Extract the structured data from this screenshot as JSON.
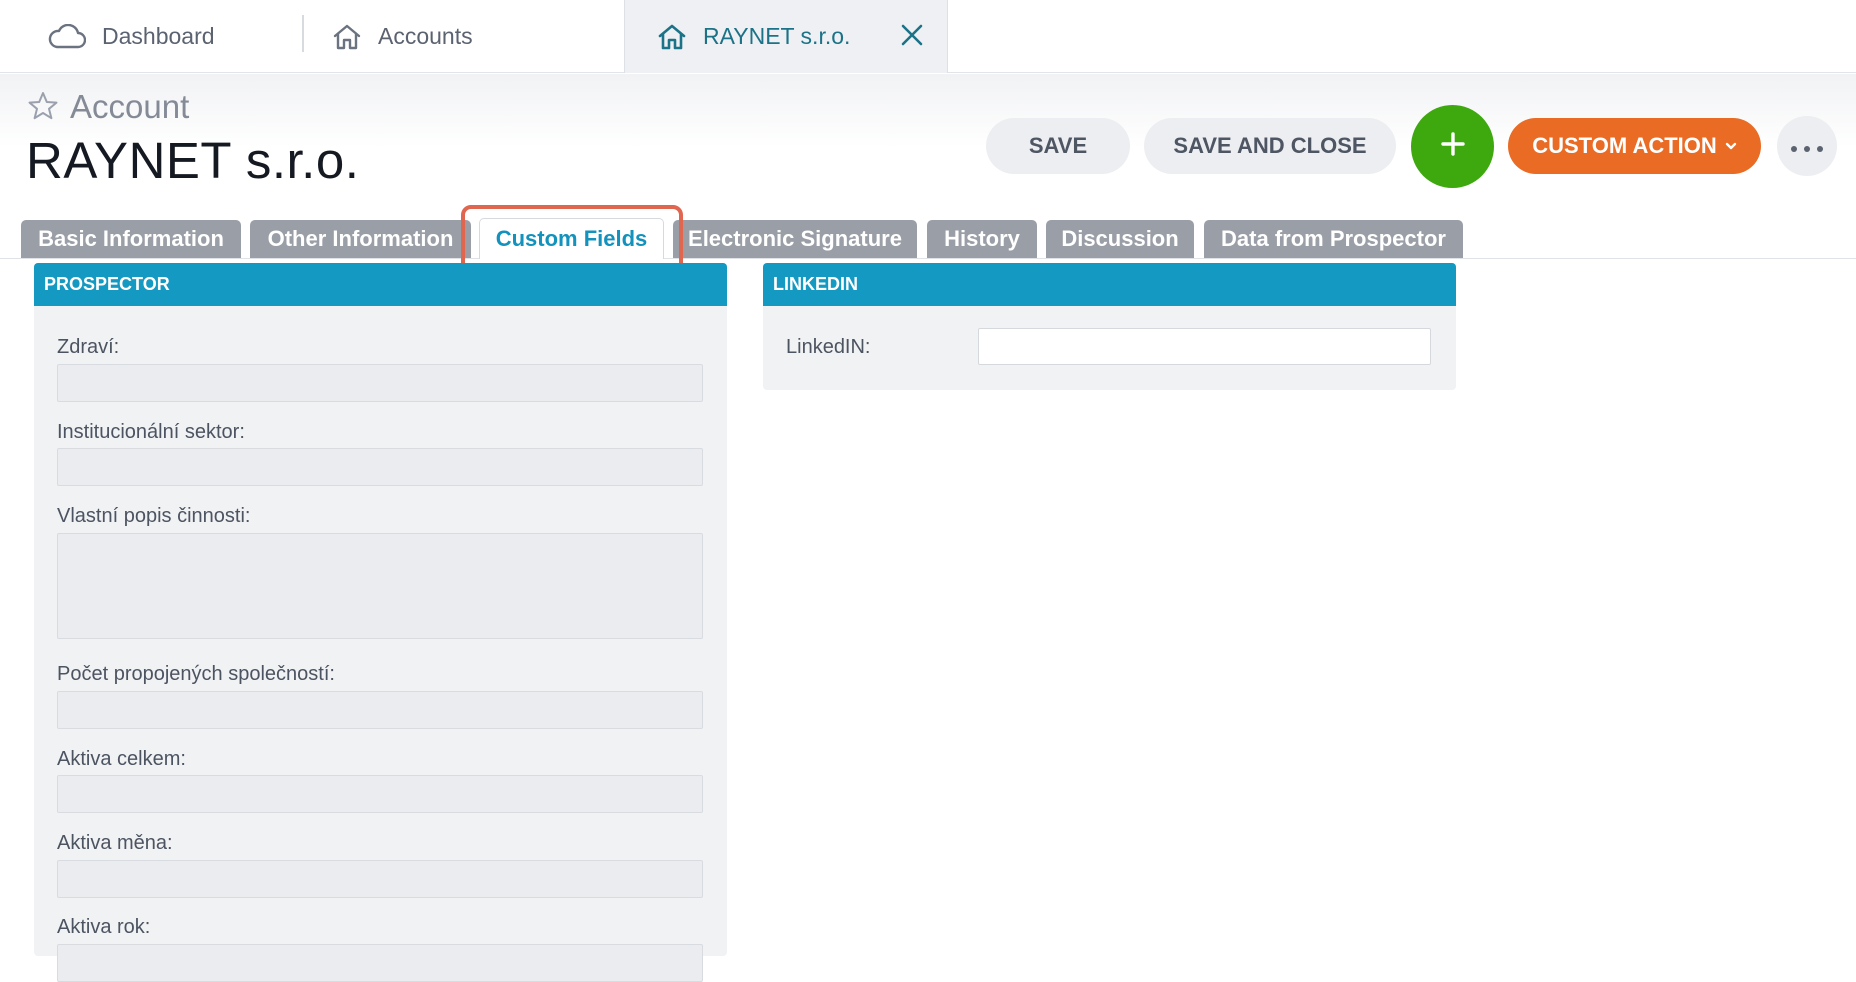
{
  "tabs": {
    "dashboard": "Dashboard",
    "accounts": "Accounts",
    "active": "RAYNET s.r.o."
  },
  "header": {
    "entity_type": "Account",
    "title": "RAYNET s.r.o."
  },
  "actions": {
    "save": "SAVE",
    "save_close": "SAVE AND CLOSE",
    "add": "+",
    "custom": "CUSTOM ACTION"
  },
  "section_tabs": [
    "Basic Information",
    "Other Information",
    "Custom Fields",
    "Electronic Signature",
    "History",
    "Discussion",
    "Data from Prospector"
  ],
  "active_section_tab": "Custom Fields",
  "prospector": {
    "title": "PROSPECTOR",
    "fields": [
      {
        "label": "Zdraví:",
        "value": ""
      },
      {
        "label": "Institucionální sektor:",
        "value": ""
      },
      {
        "label": "Vlastní popis činnosti:",
        "value": ""
      },
      {
        "label": "Počet propojených společností:",
        "value": ""
      },
      {
        "label": "Aktiva celkem:",
        "value": ""
      },
      {
        "label": "Aktiva měna:",
        "value": ""
      },
      {
        "label": "Aktiva rok:",
        "value": ""
      }
    ]
  },
  "linkedin": {
    "title": "LINKEDIN",
    "field_label": "LinkedIN:",
    "field_value": ""
  },
  "colors": {
    "accent": "#1499c2",
    "add_button": "#3ea80f",
    "custom_action": "#e96b24",
    "highlight": "#e0664f"
  }
}
